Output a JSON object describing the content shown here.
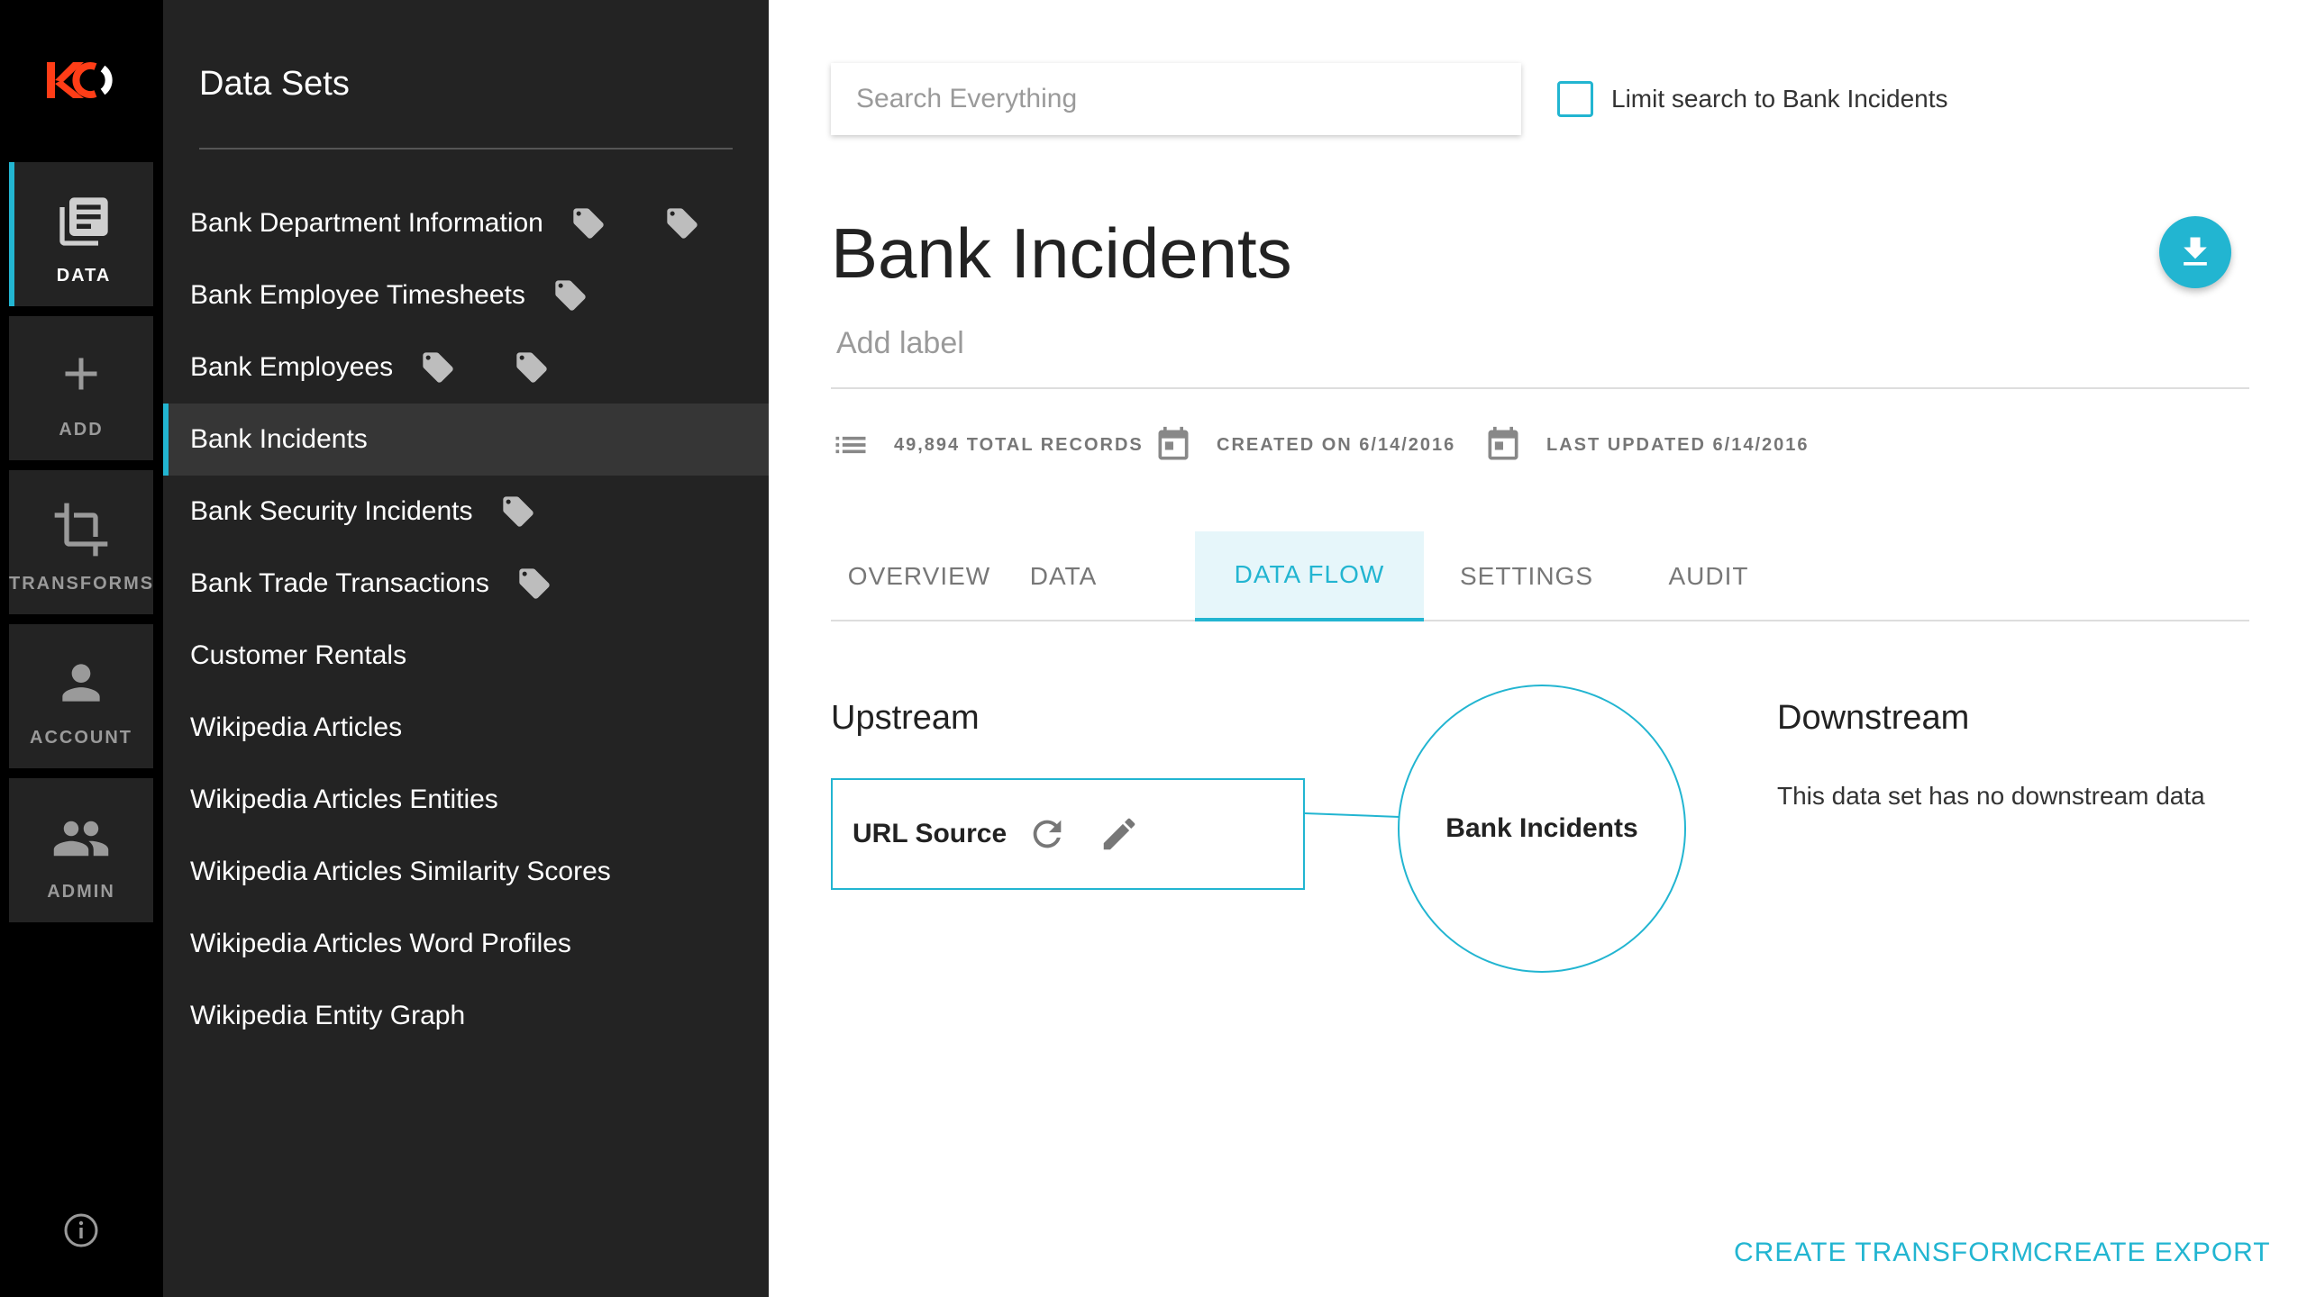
{
  "brand": {
    "logo_text": "KO",
    "accent": "#22b5d1",
    "logo_color": "#ff3d17"
  },
  "rail": {
    "items": [
      {
        "label": "DATA",
        "icon": "data-icon",
        "active": true
      },
      {
        "label": "ADD",
        "icon": "plus-icon",
        "active": false
      },
      {
        "label": "TRANSFORMS",
        "icon": "transform-icon",
        "active": false
      },
      {
        "label": "ACCOUNT",
        "icon": "person-icon",
        "active": false
      },
      {
        "label": "ADMIN",
        "icon": "group-icon",
        "active": false
      }
    ],
    "info_icon": "info-icon"
  },
  "sidebar": {
    "title": "Data Sets",
    "items": [
      {
        "label": "Bank Department Information",
        "tags": 2
      },
      {
        "label": "Bank Employee Timesheets",
        "tags": 1
      },
      {
        "label": "Bank Employees",
        "tags": 2
      },
      {
        "label": "Bank Incidents",
        "tags": 0,
        "active": true
      },
      {
        "label": "Bank Security Incidents",
        "tags": 1
      },
      {
        "label": "Bank Trade Transactions",
        "tags": 1
      },
      {
        "label": "Customer Rentals",
        "tags": 0
      },
      {
        "label": "Wikipedia Articles",
        "tags": 0
      },
      {
        "label": "Wikipedia Articles Entities",
        "tags": 0
      },
      {
        "label": "Wikipedia Articles Similarity Scores",
        "tags": 0
      },
      {
        "label": "Wikipedia Articles Word Profiles",
        "tags": 0
      },
      {
        "label": "Wikipedia Entity Graph",
        "tags": 0
      }
    ]
  },
  "search": {
    "placeholder": "Search Everything",
    "value": "",
    "limit_label": "Limit search to Bank Incidents",
    "limit_checked": false
  },
  "dataset": {
    "title": "Bank Incidents",
    "add_label_placeholder": "Add label",
    "total_records": "49,894 TOTAL RECORDS",
    "created": "CREATED ON 6/14/2016",
    "updated": "LAST UPDATED 6/14/2016"
  },
  "tabs": [
    {
      "label": "OVERVIEW",
      "active": false
    },
    {
      "label": "DATA",
      "active": false
    },
    {
      "label": "DATA FLOW",
      "active": true
    },
    {
      "label": "SETTINGS",
      "active": false
    },
    {
      "label": "AUDIT",
      "active": false
    }
  ],
  "dataflow": {
    "upstream_title": "Upstream",
    "downstream_title": "Downstream",
    "source_label": "URL Source",
    "node_label": "Bank Incidents",
    "no_downstream": "This data set has no downstream data"
  },
  "actions": {
    "create_transform": "CREATE TRANSFORM",
    "create_export": "CREATE EXPORT"
  }
}
